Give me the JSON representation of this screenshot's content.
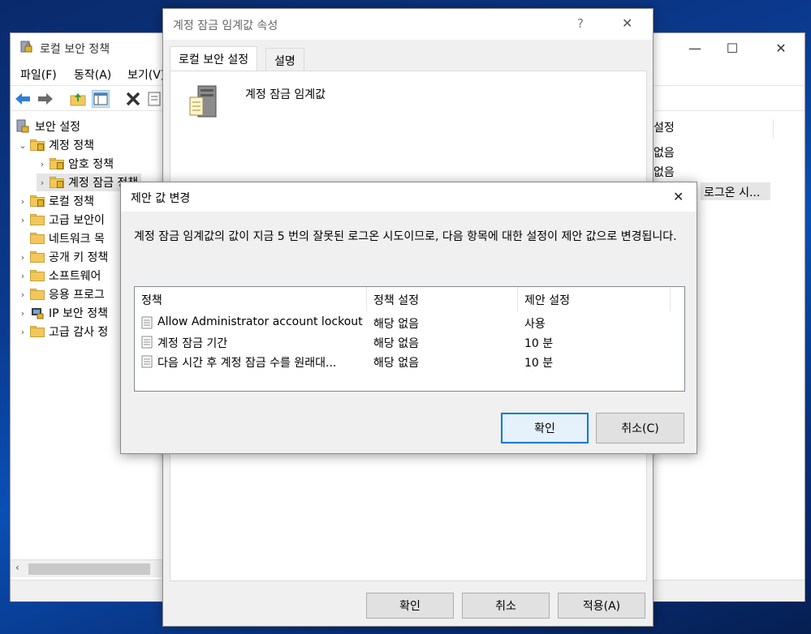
{
  "main_window": {
    "title": "로컬 보안 정책",
    "menu": [
      "파일(F)",
      "동작(A)",
      "보기(V)"
    ],
    "tree": [
      {
        "label": "보안 설정",
        "level": 0
      },
      {
        "label": "계정 정책",
        "level": 1
      },
      {
        "label": "암호 정책",
        "level": 2
      },
      {
        "label": "계정 잠금 정책",
        "level": 2
      },
      {
        "label": "로컬 정책",
        "level": 1
      },
      {
        "label": "고급 보안이",
        "level": 1
      },
      {
        "label": "네트워크 목",
        "level": 1
      },
      {
        "label": "공개 키 정책",
        "level": 1
      },
      {
        "label": "소프트웨어",
        "level": 1
      },
      {
        "label": "응용 프로그",
        "level": 1
      },
      {
        "label": "IP 보안 정책",
        "level": 1
      },
      {
        "label": "고급 감사 정",
        "level": 1
      }
    ],
    "right_list": {
      "header": "설정",
      "rows": [
        "없음",
        "없음",
        "로그온 시..."
      ]
    }
  },
  "properties_dialog": {
    "title": "계정 잠금 임계값 속성",
    "help_glyph": "?",
    "tabs": [
      "로컬 보안 설정",
      "설명"
    ],
    "policy_name": "계정 잠금 임계값",
    "buttons": {
      "ok": "확인",
      "cancel": "취소",
      "apply": "적용(A)"
    }
  },
  "suggested_dialog": {
    "title": "제안 값 변경",
    "message": "계정 잠금 임계값의 값이 지금 5 번의 잘못된 로그온 시도이므로, 다음 항목에 대한 설정이 제안 값으로 변경됩니다.",
    "columns": [
      "정책",
      "정책 설정",
      "제안 설정"
    ],
    "rows": [
      {
        "policy": "Allow Administrator account lockout",
        "current": "해당 없음",
        "suggested": "사용"
      },
      {
        "policy": "계정 잠금 기간",
        "current": "해당 없음",
        "suggested": "10 분"
      },
      {
        "policy": "다음 시간 후 계정 잠금 수를 원래대...",
        "current": "해당 없음",
        "suggested": "10 분"
      }
    ],
    "buttons": {
      "ok": "확인",
      "cancel": "취소(C)"
    }
  }
}
